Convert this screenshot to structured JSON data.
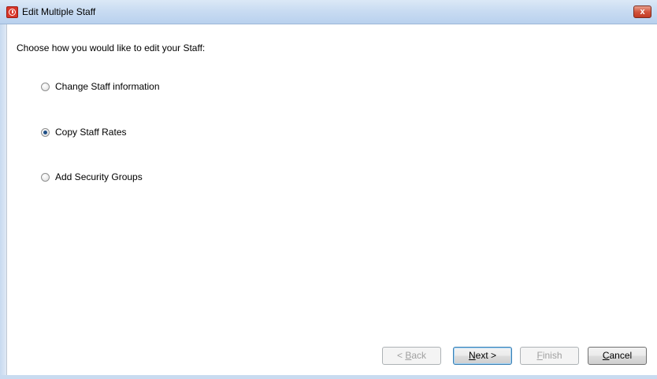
{
  "window": {
    "title": "Edit Multiple Staff",
    "close_label": "x"
  },
  "prompt": "Choose how you would like to edit your Staff:",
  "options": [
    {
      "label": "Change Staff information",
      "selected": false
    },
    {
      "label": "Copy Staff Rates",
      "selected": true
    },
    {
      "label": "Add Security Groups",
      "selected": false
    }
  ],
  "buttons": {
    "back": {
      "pre": "< ",
      "mnemonic": "B",
      "post": "ack",
      "enabled": false
    },
    "next": {
      "pre": "",
      "mnemonic": "N",
      "post": "ext >",
      "enabled": true
    },
    "finish": {
      "pre": "",
      "mnemonic": "F",
      "post": "inish",
      "enabled": false
    },
    "cancel": {
      "pre": "",
      "mnemonic": "C",
      "post": "ancel",
      "enabled": true
    }
  }
}
